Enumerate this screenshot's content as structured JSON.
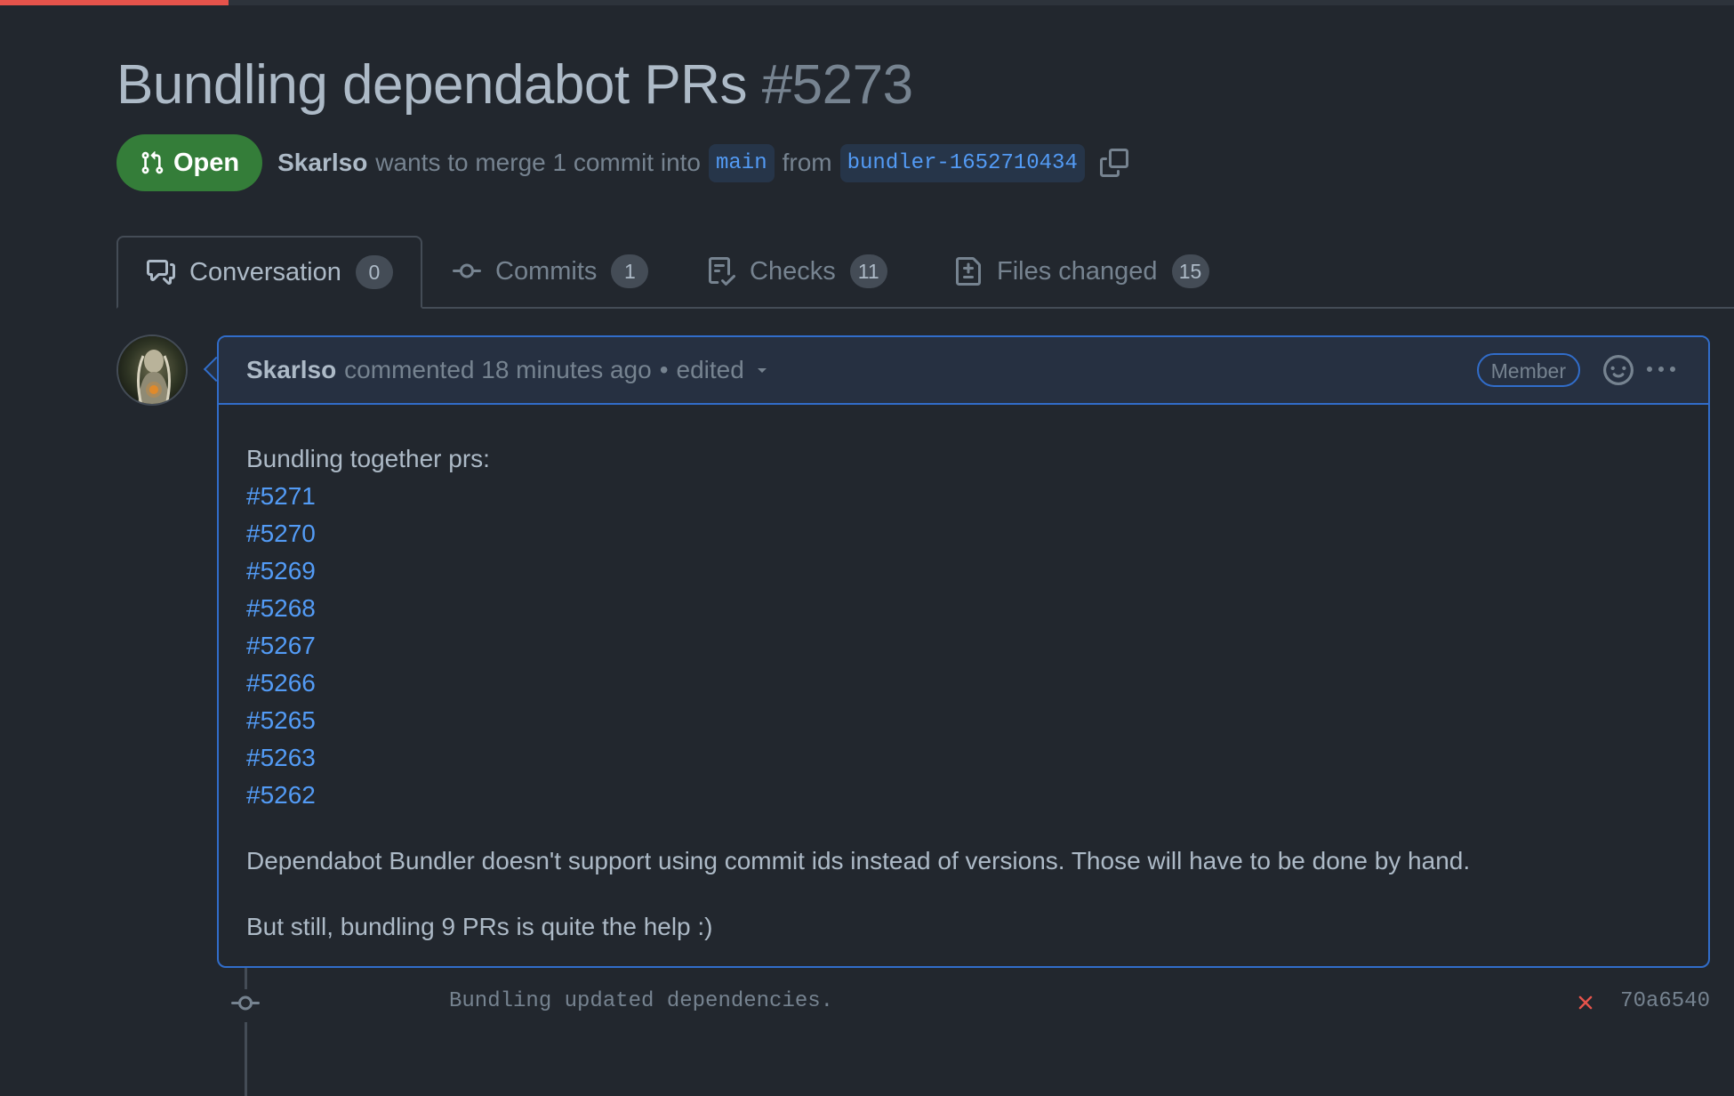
{
  "pr": {
    "title": "Bundling dependabot PRs",
    "number": "#5273",
    "state": "Open",
    "author": "Skarlso",
    "merge_text": "wants to merge 1 commit into",
    "base_branch": "main",
    "from_text": "from",
    "head_branch": "bundler-1652710434"
  },
  "tabs": [
    {
      "label": "Conversation",
      "count": "0",
      "icon": "comment-discussion-icon"
    },
    {
      "label": "Commits",
      "count": "1",
      "icon": "git-commit-icon"
    },
    {
      "label": "Checks",
      "count": "11",
      "icon": "checklist-icon"
    },
    {
      "label": "Files changed",
      "count": "15",
      "icon": "file-diff-icon"
    }
  ],
  "comment": {
    "author": "Skarlso",
    "action": "commented 18 minutes ago",
    "separator": "•",
    "edited": "edited",
    "role_badge": "Member",
    "intro": "Bundling together prs:",
    "pr_links": [
      "#5271",
      "#5270",
      "#5269",
      "#5268",
      "#5267",
      "#5266",
      "#5265",
      "#5263",
      "#5262"
    ],
    "paragraph1": "Dependabot Bundler doesn't support using commit ids instead of versions. Those will have to be done by hand.",
    "paragraph2": "But still, bundling 9 PRs is quite the help :)"
  },
  "commit": {
    "message": "Bundling updated dependencies.",
    "status": "failed",
    "sha": "70a6540"
  },
  "colors": {
    "background": "#22272e",
    "open_badge": "#347d39",
    "link": "#539bf5",
    "comment_border": "#316dca",
    "failure": "#e5534b"
  }
}
